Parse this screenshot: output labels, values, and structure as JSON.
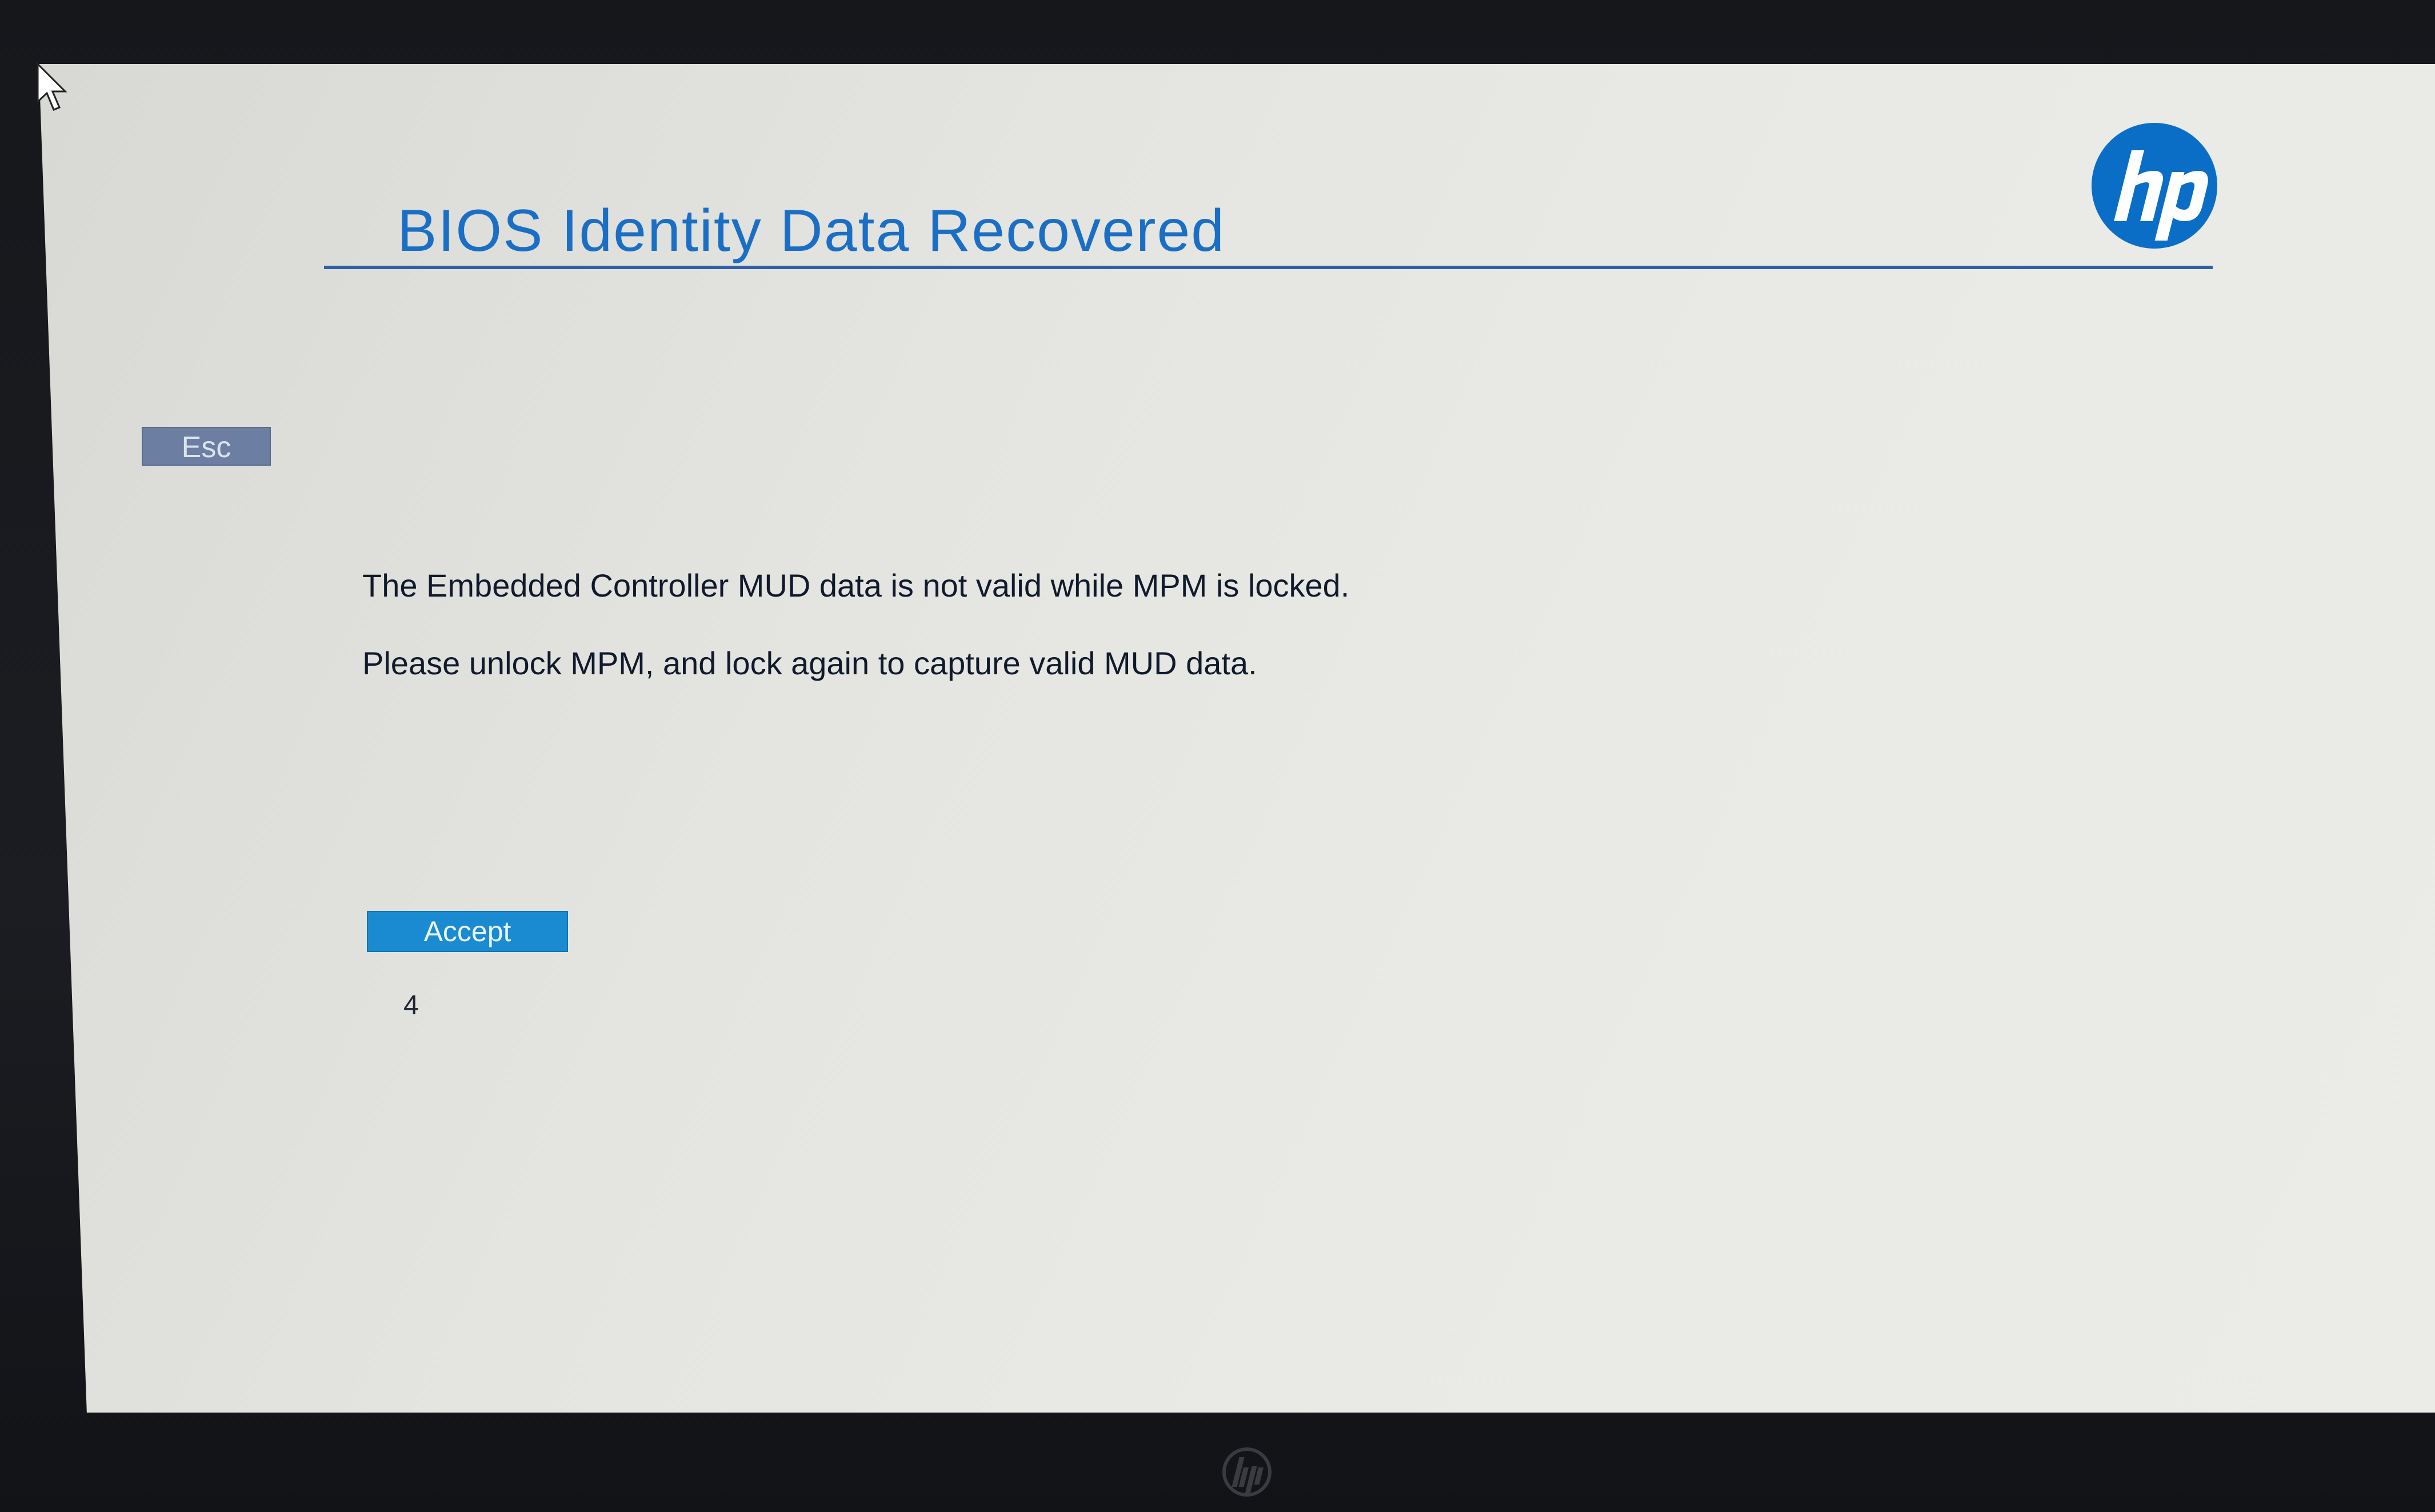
{
  "header": {
    "title": "BIOS Identity Data Recovered"
  },
  "branding": {
    "logo_text": "hp",
    "logo_color": "#0a6ec7",
    "title_color": "#1a6fc4"
  },
  "controls": {
    "esc_label": "Esc",
    "accept_label": "Accept",
    "accept_color": "#1a8bd0"
  },
  "message": {
    "line1": "The Embedded Controller MUD data is not valid while MPM is locked.",
    "line2": "Please unlock MPM, and lock again to capture valid MUD data."
  },
  "countdown": {
    "seconds": "4"
  },
  "icons": {
    "cursor": "mouse-pointer-icon",
    "logo": "hp-logo-icon",
    "bezel_logo": "hp-bezel-logo-icon"
  }
}
